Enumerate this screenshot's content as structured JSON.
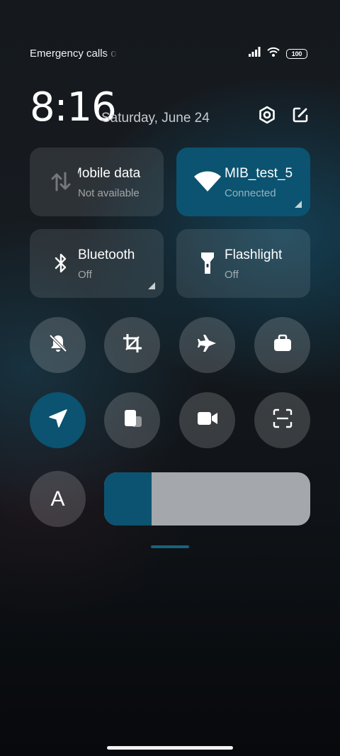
{
  "status_bar": {
    "carrier_text": "Emergency calls o",
    "battery_level": "100",
    "icons": [
      "signal-icon",
      "wifi-icon",
      "battery-icon"
    ]
  },
  "header": {
    "time": "8:16",
    "date": "Saturday, June 24",
    "settings_icon": "settings-icon",
    "edit_icon": "edit-icon"
  },
  "tiles": [
    {
      "id": "mobile-data",
      "title": "Mobile data",
      "subtitle": "Not available",
      "active": false,
      "icon": "mobile-data-icon"
    },
    {
      "id": "wifi",
      "title": "MIB_test_5",
      "subtitle": "Connected",
      "active": true,
      "icon": "wifi-icon"
    },
    {
      "id": "bluetooth",
      "title": "Bluetooth",
      "subtitle": "Off",
      "active": false,
      "icon": "bluetooth-icon"
    },
    {
      "id": "flashlight",
      "title": "Flashlight",
      "subtitle": "Off",
      "active": false,
      "icon": "flashlight-icon"
    }
  ],
  "toggles": [
    {
      "id": "mute",
      "icon": "bell-off-icon",
      "active": false
    },
    {
      "id": "screenshot",
      "icon": "crop-icon",
      "active": false
    },
    {
      "id": "airplane",
      "icon": "airplane-icon",
      "active": false
    },
    {
      "id": "work",
      "icon": "briefcase-icon",
      "active": false
    },
    {
      "id": "location",
      "icon": "location-icon",
      "active": true
    },
    {
      "id": "floating-window",
      "icon": "floating-window-icon",
      "active": false
    },
    {
      "id": "screen-recorder",
      "icon": "video-camera-icon",
      "active": false
    },
    {
      "id": "scanner",
      "icon": "scan-icon",
      "active": false
    }
  ],
  "brightness": {
    "auto_label": "A",
    "level": 0.23
  },
  "colors": {
    "accent": "#0b5370",
    "tile_bg": "#2a3036",
    "slider_track": "#a4a7ab"
  }
}
